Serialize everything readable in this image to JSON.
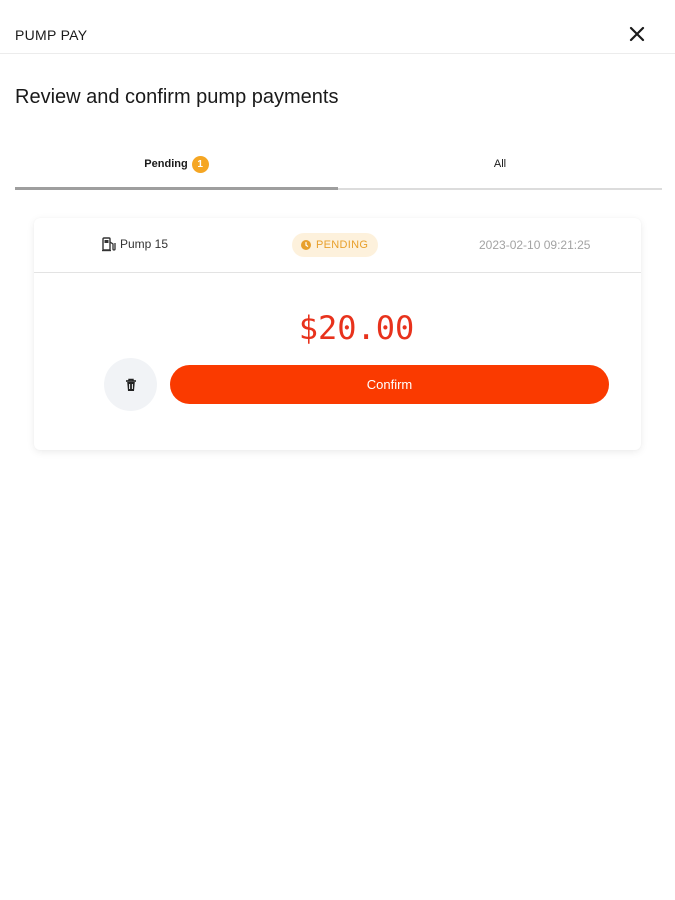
{
  "header": {
    "app_title": "PUMP PAY",
    "close_icon": "close-icon"
  },
  "page": {
    "heading": "Review and confirm pump payments"
  },
  "tabs": [
    {
      "label": "Pending",
      "badge": "1",
      "selected": true
    },
    {
      "label": "All",
      "selected": false
    }
  ],
  "payments": [
    {
      "pump_label": "Pump 15",
      "pump_icon": "fuel-pump-icon",
      "status": "PENDING",
      "status_icon": "clock-icon",
      "timestamp": "2023-02-10 09:21:25",
      "amount": "$20.00",
      "delete_icon": "trash-icon",
      "confirm_label": "Confirm"
    }
  ],
  "colors": {
    "accent": "#fa3a00",
    "amount": "#e8321c",
    "pending": "#e8a02c",
    "pending_bg": "#fdf1dc",
    "tab_badge": "#f5a623"
  }
}
